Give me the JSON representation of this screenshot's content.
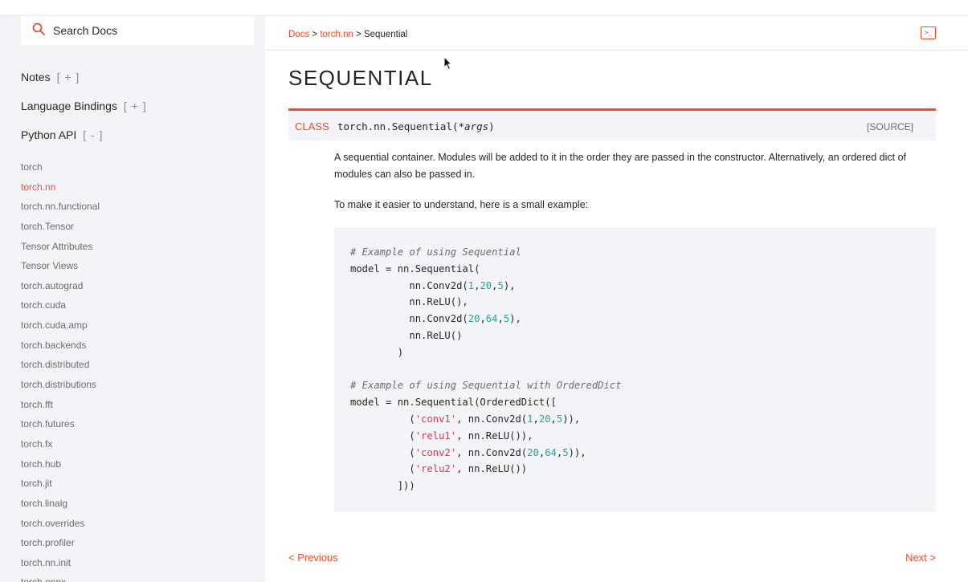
{
  "search": {
    "placeholder": "Search Docs"
  },
  "sidebar": {
    "sections": [
      {
        "label": "Notes",
        "toggle": "[ + ]"
      },
      {
        "label": "Language Bindings",
        "toggle": "[ + ]"
      },
      {
        "label": "Python API",
        "toggle": "[ - ]"
      }
    ],
    "items": [
      "torch",
      "torch.nn",
      "torch.nn.functional",
      "torch.Tensor",
      "Tensor Attributes",
      "Tensor Views",
      "torch.autograd",
      "torch.cuda",
      "torch.cuda.amp",
      "torch.backends",
      "torch.distributed",
      "torch.distributions",
      "torch.fft",
      "torch.futures",
      "torch.fx",
      "torch.hub",
      "torch.jit",
      "torch.linalg",
      "torch.overrides",
      "torch.profiler",
      "torch.nn.init",
      "torch.onnx"
    ],
    "active_index": 1
  },
  "breadcrumb": {
    "docs": "Docs",
    "sep1": " > ",
    "parent": "torch.nn",
    "sep2": " > ",
    "current": "Sequential"
  },
  "terminal_icon": ">_",
  "page_title": "SEQUENTIAL",
  "signature": {
    "kind": "CLASS",
    "name": "torch.nn.Sequential(",
    "arg": "*args",
    "close": ")",
    "source": "[SOURCE]"
  },
  "description": "A sequential container. Modules will be added to it in the order they are passed in the constructor. Alternatively, an ordered dict of modules can also be passed in.",
  "example_intro": "To make it easier to understand, here is a small example:",
  "code": {
    "comment1": "# Example of using Sequential",
    "comment2": "# Example of using Sequential with OrderedDict"
  },
  "nav": {
    "prev": "< Previous",
    "next": "Next >"
  },
  "colors": {
    "accent": "#ee4c2c",
    "sidebar_bg": "#f3f4f7",
    "code_bg": "#f3f4f7"
  }
}
